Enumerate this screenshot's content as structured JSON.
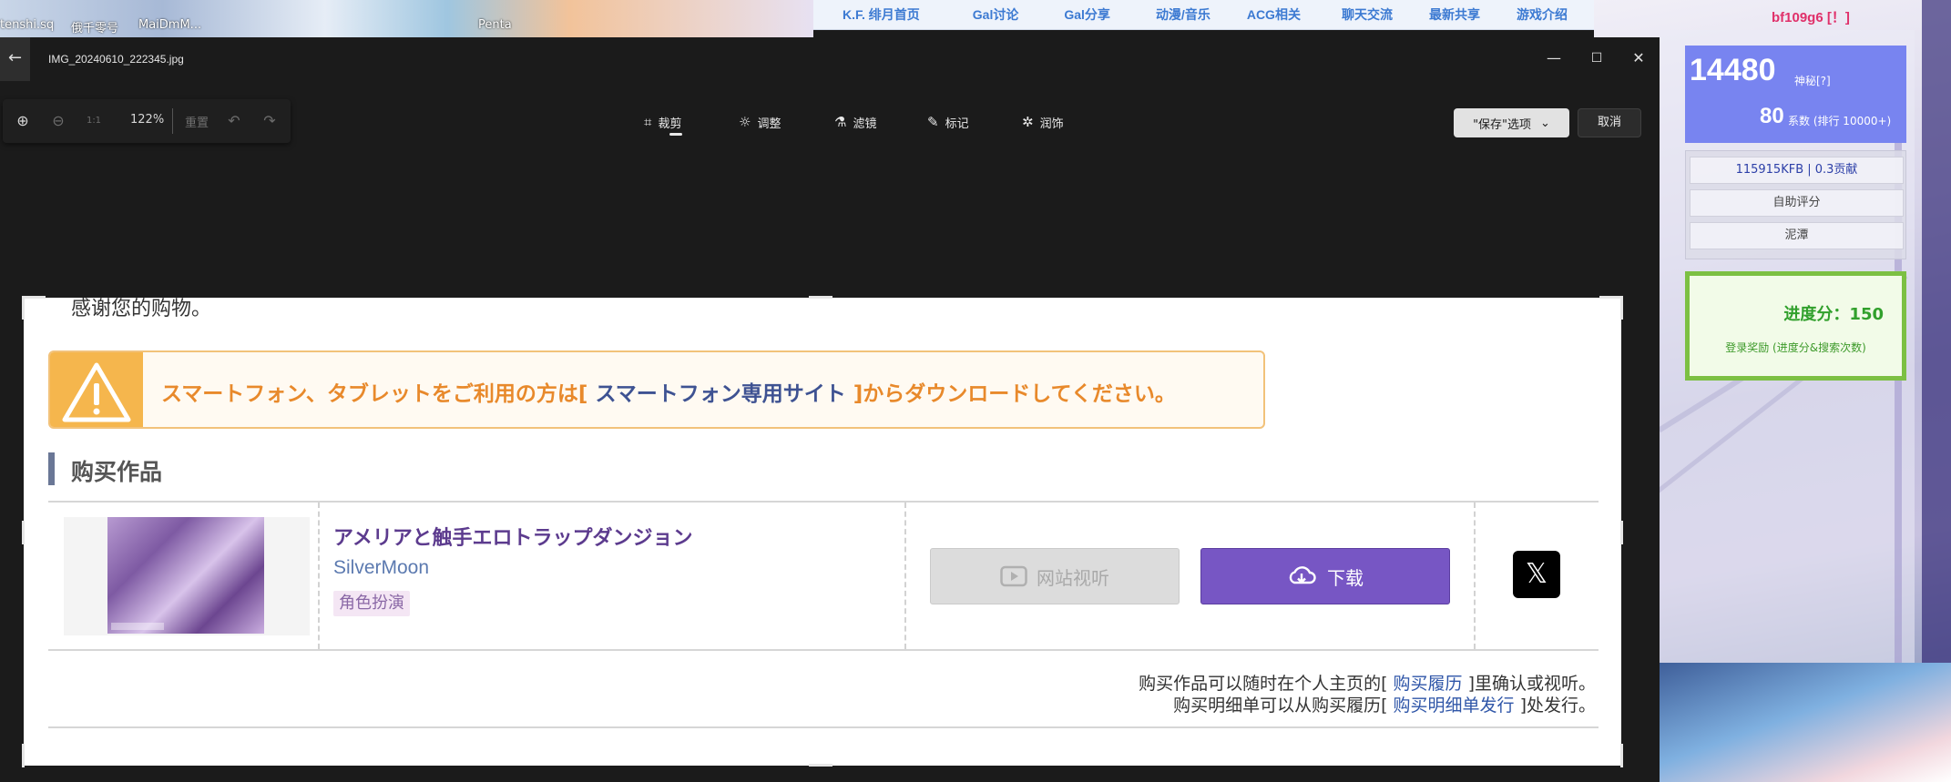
{
  "background": {
    "desktop_labels": [
      "tenshi.sq",
      "俄千零号",
      "MaiDmM..."
    ],
    "desktop_label_right": "Penta",
    "nav": [
      "K.F. 绯月首页",
      "Gal讨论",
      "Gal分享",
      "动漫/音乐",
      "ACG相关",
      "聊天交流",
      "最新共享",
      "游戏介绍"
    ],
    "username": "bf109g6 [！]",
    "score_main": "14480",
    "score_label": "神秘[?]",
    "score_num2": "80",
    "score_rank": "系数 (排行 10000+)",
    "info_rows": [
      "115915KFB | 0.3贡献",
      "自助评分",
      "泥潭"
    ],
    "progress_title": "进度分：150",
    "progress_sub": "登录奖励 (进度分&搜索次数)"
  },
  "app": {
    "back_icon": "←",
    "file_name": "IMG_20240610_222345.jpg",
    "window_controls": {
      "minimize": "—",
      "maximize": "☐",
      "close": "✕"
    },
    "zoom_in_icon": "⊕",
    "zoom_out_icon": "⊖",
    "fit_icon": "1:1",
    "zoom_value": "122%",
    "reset_label": "重置",
    "undo_icon": "↶",
    "redo_icon": "↷",
    "modes": [
      {
        "icon": "⌗",
        "label": "裁剪"
      },
      {
        "icon": "☼",
        "label": "调整"
      },
      {
        "icon": "⚗",
        "label": "滤镜"
      },
      {
        "icon": "✎",
        "label": "标记"
      },
      {
        "icon": "✲",
        "label": "润饰"
      }
    ],
    "save_label": "\"保存\"选项",
    "save_chevron": "⌄",
    "cancel_label": "取消"
  },
  "image": {
    "thanks_text": "感谢您的购物。",
    "notice_prefix": "スマートフォン、タブレットをご利用の方は[",
    "notice_link": " スマートフォン専用サイト ",
    "notice_suffix": "]からダウンロードしてください。",
    "section_title": "购买作品",
    "work_title": "アメリアと触手エロトラップダンジョン",
    "circle_name": "SilverMoon",
    "genre": "角色扮演",
    "site_view_label": "网站视听",
    "download_label": "下载",
    "x_logo": "𝕏",
    "footer1_prefix": "购买作品可以随时在个人主页的[",
    "footer1_link": " 购买履历 ",
    "footer1_suffix": "]里确认或视听。",
    "footer2_prefix": "购买明细单可以从购买履历[",
    "footer2_link": " 购买明细单发行 ",
    "footer2_suffix": "]处发行。"
  }
}
